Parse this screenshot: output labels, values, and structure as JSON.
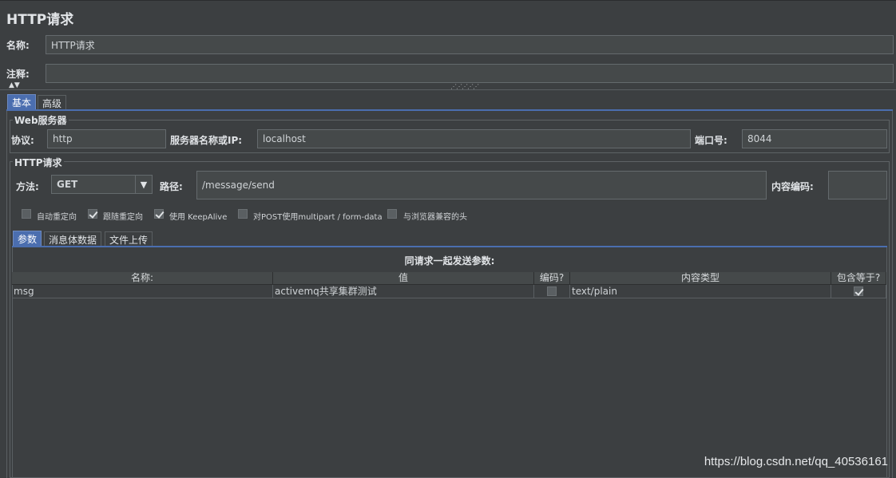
{
  "title": "HTTP请求",
  "name": {
    "label": "名称:",
    "value": "HTTP请求"
  },
  "comment": {
    "label": "注释:",
    "value": ""
  },
  "tabs": [
    {
      "label": "基本"
    },
    {
      "label": "高级"
    }
  ],
  "web_server": {
    "title": "Web服务器",
    "protocol_label": "协议:",
    "protocol_value": "http",
    "server_label": "服务器名称或IP:",
    "server_value": "localhost",
    "port_label": "端口号:",
    "port_value": "8044"
  },
  "http_request": {
    "title": "HTTP请求",
    "method_label": "方法:",
    "method_value": "GET",
    "path_label": "路径:",
    "path_value": "/message/send",
    "encoding_label": "内容编码:",
    "encoding_value": ""
  },
  "options": [
    {
      "label": "自动重定向",
      "checked": false
    },
    {
      "label": "跟随重定向",
      "checked": true
    },
    {
      "label": "使用 KeepAlive",
      "checked": true
    },
    {
      "label": "对POST使用multipart / form-data",
      "checked": false
    },
    {
      "label": "与浏览器兼容的头",
      "checked": false
    }
  ],
  "sub_tabs": [
    {
      "label": "参数"
    },
    {
      "label": "消息体数据"
    },
    {
      "label": "文件上传"
    }
  ],
  "params": {
    "caption": "同请求一起发送参数:",
    "columns": [
      "名称:",
      "值",
      "编码?",
      "内容类型",
      "包含等于?"
    ],
    "rows": [
      {
        "name": "msg",
        "value": "activemq共享集群测试",
        "encode": false,
        "content_type": "text/plain",
        "include_equals": true
      }
    ]
  },
  "watermark": "https://blog.csdn.net/qq_40536161",
  "colors": {
    "background": "#3c3f41",
    "field": "#45494a",
    "active_tab": "#4b6eaf"
  }
}
